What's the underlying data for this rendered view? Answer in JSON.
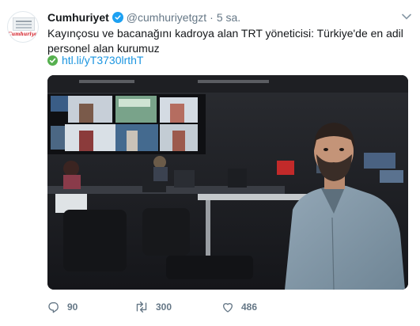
{
  "tweet": {
    "avatar_brand": "Cumhuriyet",
    "display_name": "Cumhuriyet",
    "handle": "@cumhuriyetgzt",
    "separator": "·",
    "time": "5 sa.",
    "text": "Kayınçosu ve bacanağını kadroya alan TRT yöneticisi: Türkiye'de en adil personel alan kurumuz",
    "link": "htl.li/yT3730lrthT",
    "counts": {
      "replies": "90",
      "retweets": "300",
      "likes": "486"
    }
  },
  "colors": {
    "verified": "#1da1f2",
    "link": "#1b95e0",
    "muted": "#657786",
    "check": "#56b04f",
    "brand_red": "#d31f28"
  },
  "icons": [
    "verified-badge-icon",
    "chevron-down-icon",
    "check-circle-icon",
    "reply-icon",
    "retweet-icon",
    "like-heart-icon"
  ]
}
